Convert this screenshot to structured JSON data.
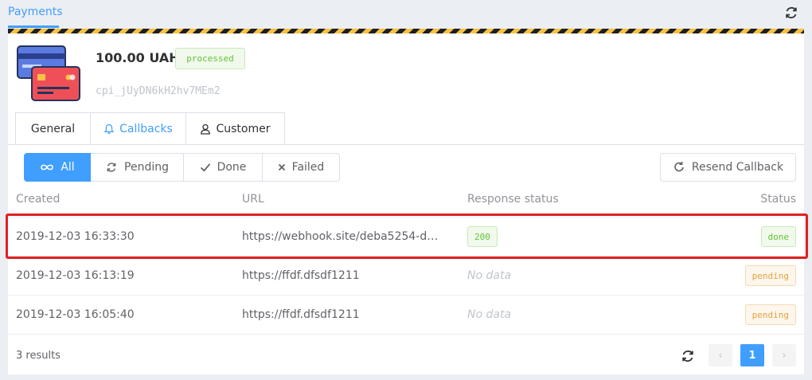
{
  "header": {
    "title": "Payments",
    "refresh_icon": "refresh-icon"
  },
  "payment": {
    "amount": "100.00 UAH",
    "status": "processed",
    "id": "cpi_jUyDN6kH2hv7MEm2",
    "icon": "credit-cards-icon"
  },
  "tabs": [
    {
      "label": "General",
      "icon": ""
    },
    {
      "label": "Callbacks",
      "icon": "bell-icon",
      "active": true
    },
    {
      "label": "Customer",
      "icon": "user-icon"
    }
  ],
  "filters": [
    {
      "label": "All",
      "icon": "infinity-icon",
      "active": true
    },
    {
      "label": "Pending",
      "icon": "sync-icon"
    },
    {
      "label": "Done",
      "icon": "check-icon"
    },
    {
      "label": "Failed",
      "icon": "close-icon"
    }
  ],
  "resend_label": "Resend Callback",
  "table": {
    "columns": [
      "Created",
      "URL",
      "Response status",
      "Status"
    ],
    "rows": [
      {
        "created": "2019-12-03 16:33:30",
        "url": "https://webhook.site/deba5254-d6...",
        "response": "200",
        "status": "done"
      },
      {
        "created": "2019-12-03 16:13:19",
        "url": "https://ffdf.dfsdf1211",
        "response": "No data",
        "status": "pending"
      },
      {
        "created": "2019-12-03 16:05:40",
        "url": "https://ffdf.dfsdf1211",
        "response": "No data",
        "status": "pending"
      }
    ]
  },
  "footer": {
    "results": "3 results",
    "prev": "‹",
    "current_page": "1",
    "next": "›"
  },
  "colors": {
    "accent": "#409eff",
    "success": "#67c23a",
    "warning": "#e6a23c",
    "highlight": "#e02020"
  }
}
